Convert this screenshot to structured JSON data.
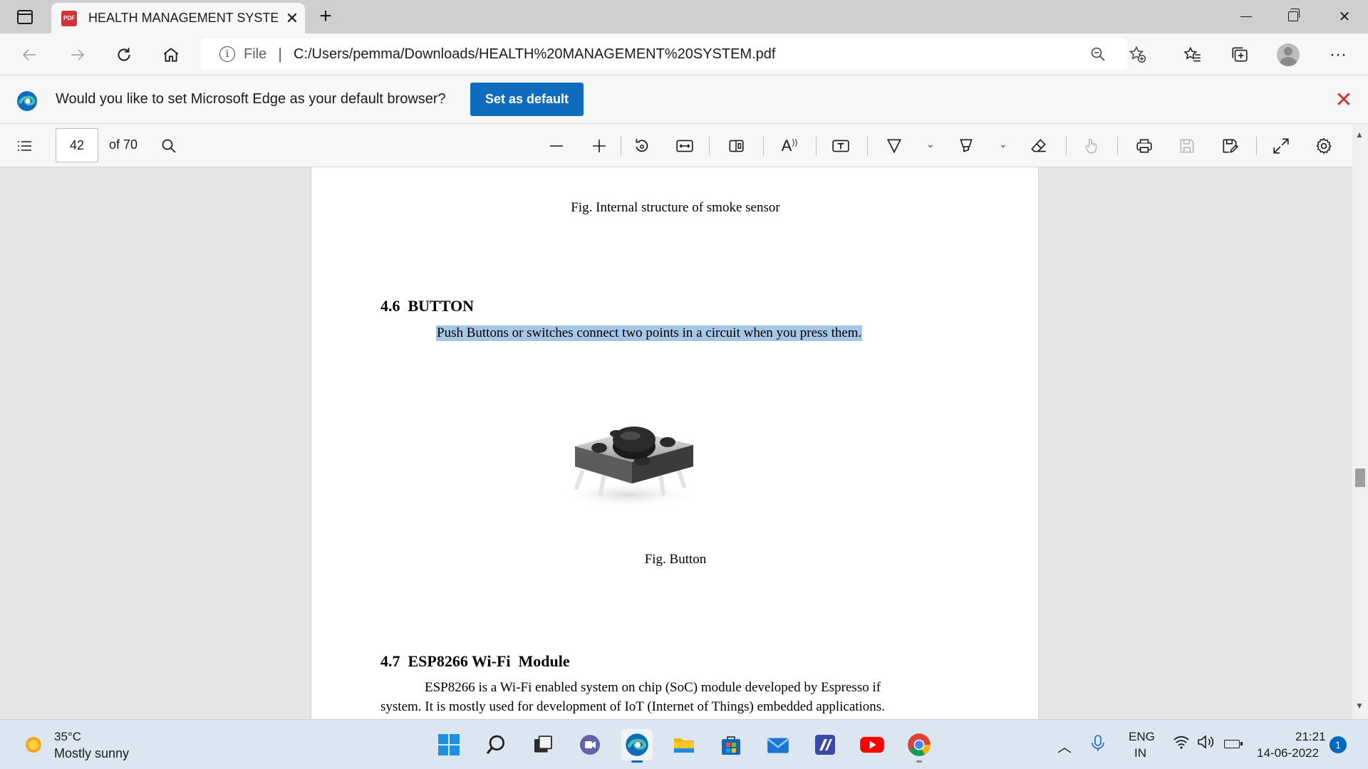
{
  "browser": {
    "tab_title": "HEALTH MANAGEMENT SYSTEM",
    "pdf_badge": "PDF",
    "address_scheme": "File",
    "url": "C:/Users/pemma/Downloads/HEALTH%20MANAGEMENT%20SYSTEM.pdf"
  },
  "infobar": {
    "message": "Would you like to set Microsoft Edge as your default browser?",
    "button_label": "Set as default"
  },
  "pdf_toolbar": {
    "page_number": "42",
    "page_total_label": "of 70"
  },
  "document": {
    "caption_smoke": "Fig. Internal structure of smoke sensor",
    "heading_46": "4.6  BUTTON",
    "para_button": "Push Buttons or switches connect two points in a circuit when you press them.",
    "caption_button": "Fig. Button",
    "heading_47": "4.7  ESP8266 Wi-Fi  Module",
    "para_esp_line1": "ESP8266 is a Wi-Fi enabled system on chip (SoC) module developed by Espresso if",
    "para_esp_line2": "system. It is mostly used for development of IoT (Internet of Things) embedded applications."
  },
  "taskbar": {
    "weather_temp": "35°C",
    "weather_desc": "Mostly sunny",
    "lang_line1": "ENG",
    "lang_line2": "IN",
    "time": "21:21",
    "date": "14-06-2022",
    "notification_count": "1"
  },
  "colors": {
    "accent": "#0f6cbd",
    "highlight": "#a6c6e8",
    "close_red": "#d13438"
  }
}
